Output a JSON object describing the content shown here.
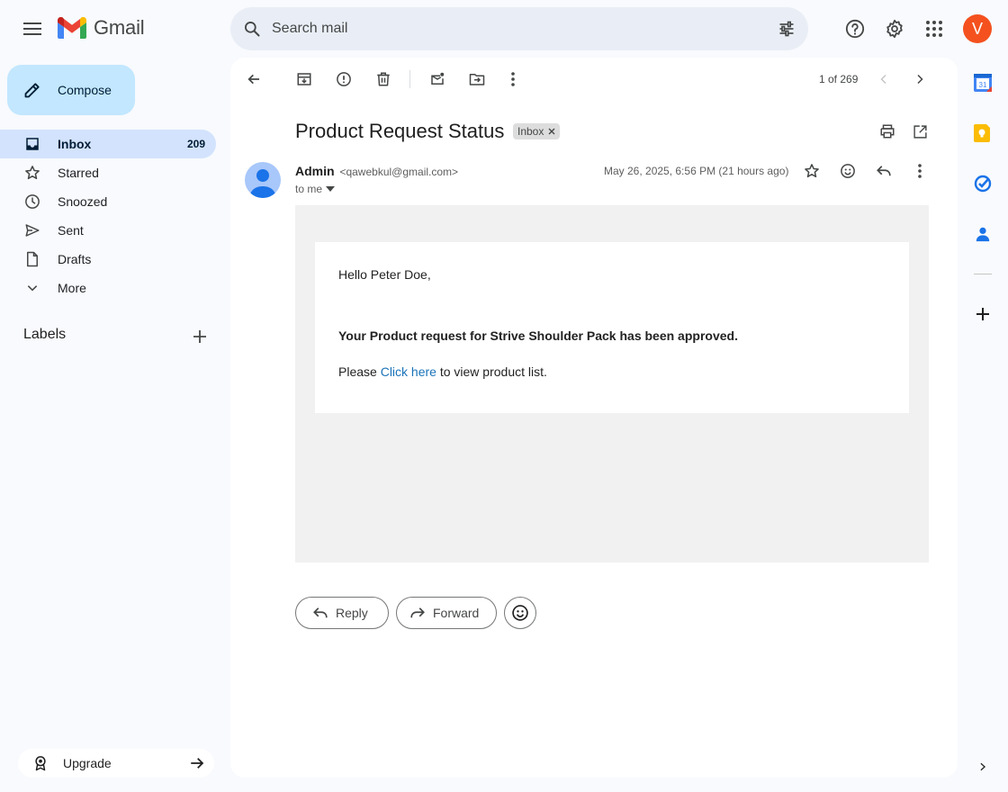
{
  "header": {
    "logo_text": "Gmail",
    "search_placeholder": "Search mail",
    "avatar_letter": "V"
  },
  "sidebar": {
    "compose_label": "Compose",
    "items": [
      {
        "label": "Inbox",
        "count": "209",
        "icon": "inbox-icon",
        "active": true
      },
      {
        "label": "Starred",
        "count": "",
        "icon": "star-icon"
      },
      {
        "label": "Snoozed",
        "count": "",
        "icon": "clock-icon"
      },
      {
        "label": "Sent",
        "count": "",
        "icon": "send-icon"
      },
      {
        "label": "Drafts",
        "count": "",
        "icon": "draft-icon"
      },
      {
        "label": "More",
        "count": "",
        "icon": "chevron-down-icon"
      }
    ],
    "labels_title": "Labels",
    "upgrade_label": "Upgrade"
  },
  "toolbar": {
    "pager_text": "1 of 269"
  },
  "message": {
    "subject": "Product Request Status",
    "chip_label": "Inbox",
    "sender_name": "Admin",
    "sender_email": "<qawebkul@gmail.com>",
    "to_line": "to me",
    "date": "May 26, 2025, 6:56 PM (21 hours ago)",
    "greeting": "Hello Peter Doe,",
    "approved_text": "Your Product request for Strive Shoulder Pack has been approved.",
    "cta_prefix": "Please ",
    "cta_link": "Click here",
    "cta_suffix": " to view product list."
  },
  "actions": {
    "reply_label": "Reply",
    "forward_label": "Forward"
  },
  "side_apps": {
    "calendar_day": "31"
  },
  "colors": {
    "accent": "#0b57d0",
    "active_nav": "#d3e3fd",
    "compose_bg": "#c2e7ff",
    "avatar_bg": "#f4511e",
    "link": "#1a73b8"
  }
}
